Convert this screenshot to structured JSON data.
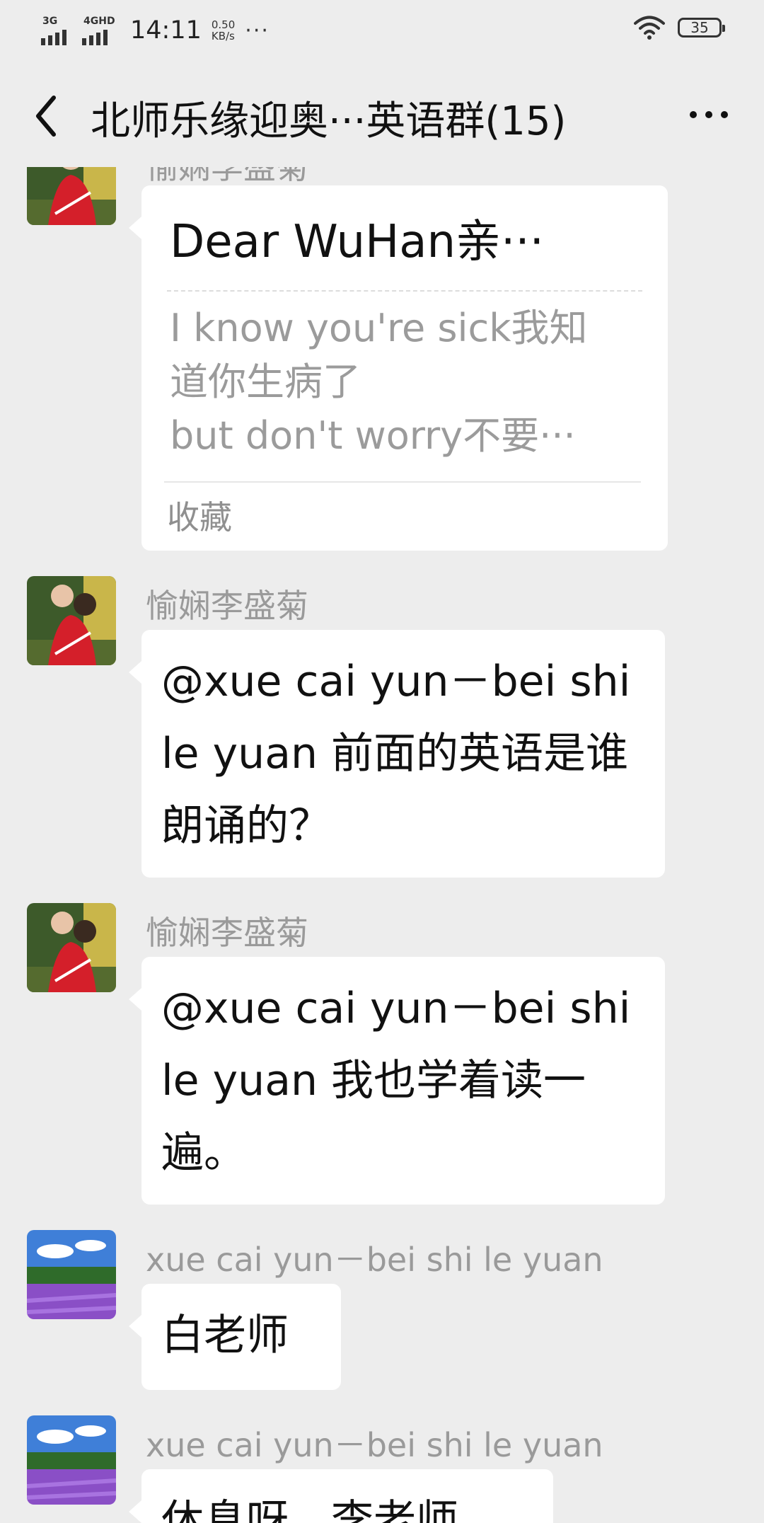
{
  "status_bar": {
    "network1": "3G",
    "network2": "4GHD",
    "time": "14:11",
    "speed_value": "0.50",
    "speed_unit": "KB/s",
    "dots": "···",
    "battery": "35"
  },
  "header": {
    "title": "北师乐缘迎奥···英语群(15)"
  },
  "messages": [
    {
      "sender": "愉娴李盛菊",
      "card_title": "Dear WuHan亲···",
      "card_line1": "I know you're sick我知",
      "card_line2": "道你生病了",
      "card_line3": "but don't worry不要···",
      "card_footer": "收藏"
    },
    {
      "sender": "愉娴李盛菊",
      "text": "@xue cai yun－bei shi le yuan 前面的英语是谁朗诵的？"
    },
    {
      "sender": "愉娴李盛菊",
      "text": "@xue cai yun－bei shi le yuan 我也学着读一遍。"
    },
    {
      "sender": "xue cai yun－bei shi le yuan",
      "text": "白老师"
    },
    {
      "sender": "xue cai yun－bei shi le yuan",
      "text": "休息呀，李老师"
    }
  ],
  "icons": {
    "back": "chevron-left-icon",
    "more": "more-dots-icon",
    "wifi": "wifi-icon",
    "battery": "battery-icon"
  },
  "colors": {
    "background": "#ededed",
    "bubble": "#ffffff",
    "sender_name": "#9a9a9a"
  }
}
